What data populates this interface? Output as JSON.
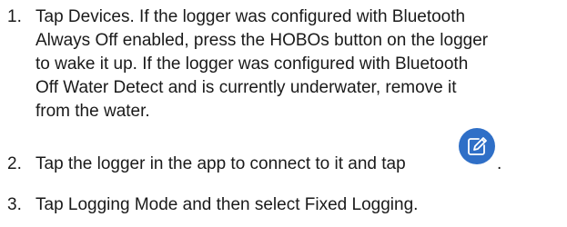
{
  "steps": [
    {
      "number": "1.",
      "lines": [
        "Tap Devices. If the logger was configured with Bluetooth",
        "Always Off enabled, press the HOBOs button on the logger",
        "to wake it up. If the logger was configured with Bluetooth",
        "Off Water Detect and is currently underwater, remove it",
        "from the water."
      ]
    },
    {
      "number": "2.",
      "lines": [
        "Tap the logger in the app to connect to it and tap"
      ],
      "after_icon": ".",
      "icon": "edit-icon",
      "icon_color": "#2f6fc7"
    },
    {
      "number": "3.",
      "lines": [
        "Tap Logging Mode and then select Fixed Logging."
      ]
    }
  ]
}
